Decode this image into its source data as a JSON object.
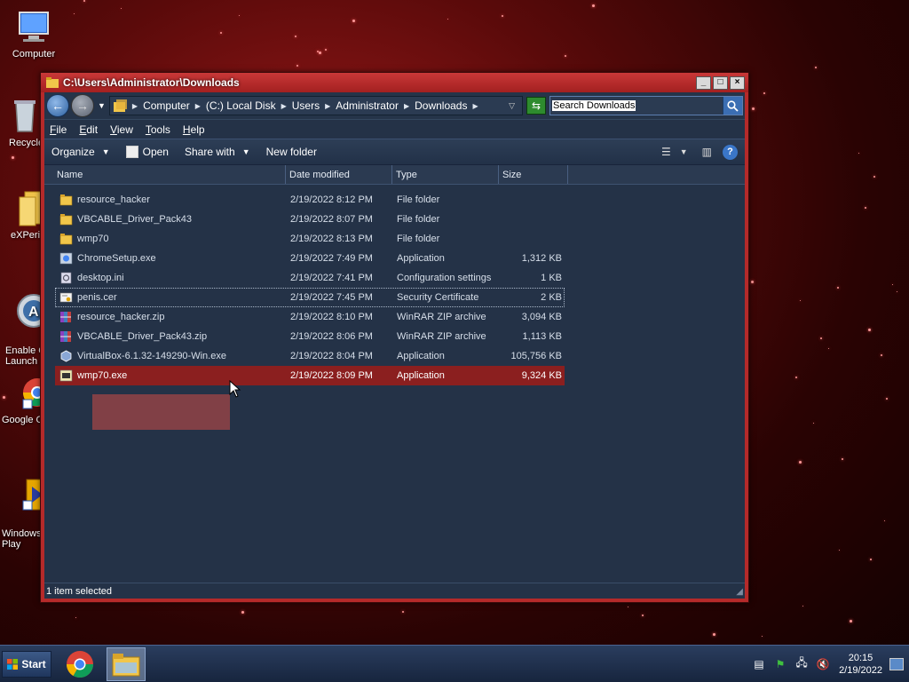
{
  "desktop": {
    "icons": [
      {
        "label": "Computer",
        "icon": "computer-icon"
      },
      {
        "label": "Recycle",
        "icon": "recycle-bin-icon"
      },
      {
        "label": "eXPeri",
        "icon": "folder-icon"
      },
      {
        "label": "Enable C\nLaunch",
        "icon": "launcher-icon"
      },
      {
        "label": "Google C",
        "icon": "chrome-icon"
      },
      {
        "label": "Windows\nPlay",
        "icon": "media-player-icon"
      }
    ]
  },
  "window": {
    "title": "C:\\Users\\Administrator\\Downloads",
    "controls": {
      "minimize": "_",
      "maximize": "□",
      "close": "×"
    }
  },
  "address": {
    "crumbs": [
      "Computer",
      "(C:) Local Disk",
      "Users",
      "Administrator",
      "Downloads"
    ],
    "search_placeholder": "Search Downloads"
  },
  "menu": [
    "File",
    "Edit",
    "View",
    "Tools",
    "Help"
  ],
  "toolbar": {
    "organize": "Organize",
    "open": "Open",
    "share_with": "Share with",
    "new_folder": "New folder"
  },
  "columns": [
    "Name",
    "Date modified",
    "Type",
    "Size"
  ],
  "files": [
    {
      "name": "resource_hacker",
      "date": "2/19/2022 8:12 PM",
      "type": "File folder",
      "size": "",
      "icon": "folder-icon"
    },
    {
      "name": "VBCABLE_Driver_Pack43",
      "date": "2/19/2022 8:07 PM",
      "type": "File folder",
      "size": "",
      "icon": "folder-icon"
    },
    {
      "name": "wmp70",
      "date": "2/19/2022 8:13 PM",
      "type": "File folder",
      "size": "",
      "icon": "folder-icon"
    },
    {
      "name": "ChromeSetup.exe",
      "date": "2/19/2022 7:49 PM",
      "type": "Application",
      "size": "1,312 KB",
      "icon": "installer-icon"
    },
    {
      "name": "desktop.ini",
      "date": "2/19/2022 7:41 PM",
      "type": "Configuration settings",
      "size": "1 KB",
      "icon": "settings-file-icon"
    },
    {
      "name": "penis.cer",
      "date": "2/19/2022 7:45 PM",
      "type": "Security Certificate",
      "size": "2 KB",
      "icon": "certificate-icon"
    },
    {
      "name": "resource_hacker.zip",
      "date": "2/19/2022 8:10 PM",
      "type": "WinRAR ZIP archive",
      "size": "3,094 KB",
      "icon": "archive-icon"
    },
    {
      "name": "VBCABLE_Driver_Pack43.zip",
      "date": "2/19/2022 8:06 PM",
      "type": "WinRAR ZIP archive",
      "size": "1,113 KB",
      "icon": "archive-icon"
    },
    {
      "name": "VirtualBox-6.1.32-149290-Win.exe",
      "date": "2/19/2022 8:04 PM",
      "type": "Application",
      "size": "105,756 KB",
      "icon": "virtualbox-icon"
    },
    {
      "name": "wmp70.exe",
      "date": "2/19/2022 8:09 PM",
      "type": "Application",
      "size": "9,324 KB",
      "icon": "exe-icon"
    }
  ],
  "status": {
    "text": "1 item selected"
  },
  "taskbar": {
    "start_label": "Start",
    "clock_time": "20:15",
    "clock_date": "2/19/2022"
  }
}
